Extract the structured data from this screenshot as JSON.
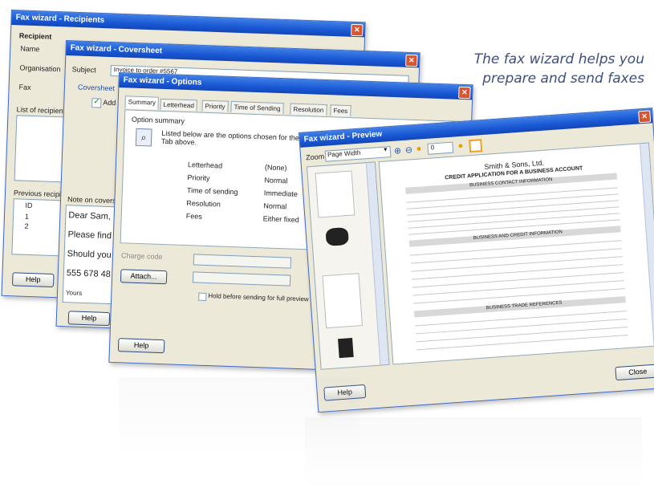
{
  "tagline": {
    "line1": "The fax wizard helps you",
    "line2": "prepare and send faxes"
  },
  "windows": {
    "recipients": {
      "title": "Fax wizard - Recipients",
      "group_label": "Recipient",
      "fields": [
        "Name",
        "Organisation",
        "Fax"
      ],
      "list_label": "List of recipients",
      "previous_label": "Previous recipients",
      "previous_col": "ID",
      "previous_rows": [
        "1",
        "2"
      ],
      "help_label": "Help"
    },
    "coversheet": {
      "title": "Fax wizard - Coversheet",
      "subject_label": "Subject",
      "subject_value": "Invoice to order #5567",
      "coversheet_label": "Coversheet",
      "add_label": "Add",
      "note_label": "Note on coversheet",
      "note_lines": [
        "Dear Sam,",
        "Please find",
        "Should you",
        "555 678 48"
      ],
      "signature": "Yours",
      "help_label": "Help"
    },
    "options": {
      "title": "Fax wizard - Options",
      "tabs": [
        "Summary",
        "Letterhead",
        "Priority",
        "Time of Sending",
        "Resolution",
        "Fees"
      ],
      "summary_label": "Option summary",
      "summary_text": "Listed below are the options chosen for the fax. Tab above.",
      "rows": [
        {
          "name": "Letterhead",
          "value": "(None)"
        },
        {
          "name": "Priority",
          "value": "Normal"
        },
        {
          "name": "Time of sending",
          "value": "Immediate"
        },
        {
          "name": "Resolution",
          "value": "Normal"
        },
        {
          "name": "Fees",
          "value": "Either fixed"
        }
      ],
      "charge_label": "Charge code",
      "attach_label": "Attach...",
      "hold_label": "Hold before sending for full preview",
      "help_label": "Help"
    },
    "preview": {
      "title": "Fax wizard - Preview",
      "zoom_label": "Zoom",
      "zoom_value": "Page Width",
      "page_value": "0",
      "doc_company": "Smith & Sons, Ltd.",
      "doc_heading": "CREDIT APPLICATION FOR A BUSINESS ACCOUNT",
      "doc_sections": [
        "BUSINESS CONTACT INFORMATION",
        "BUSINESS AND CREDIT INFORMATION",
        "BUSINESS TRADE REFERENCES"
      ],
      "help_label": "Help",
      "close_label": "Close"
    }
  }
}
